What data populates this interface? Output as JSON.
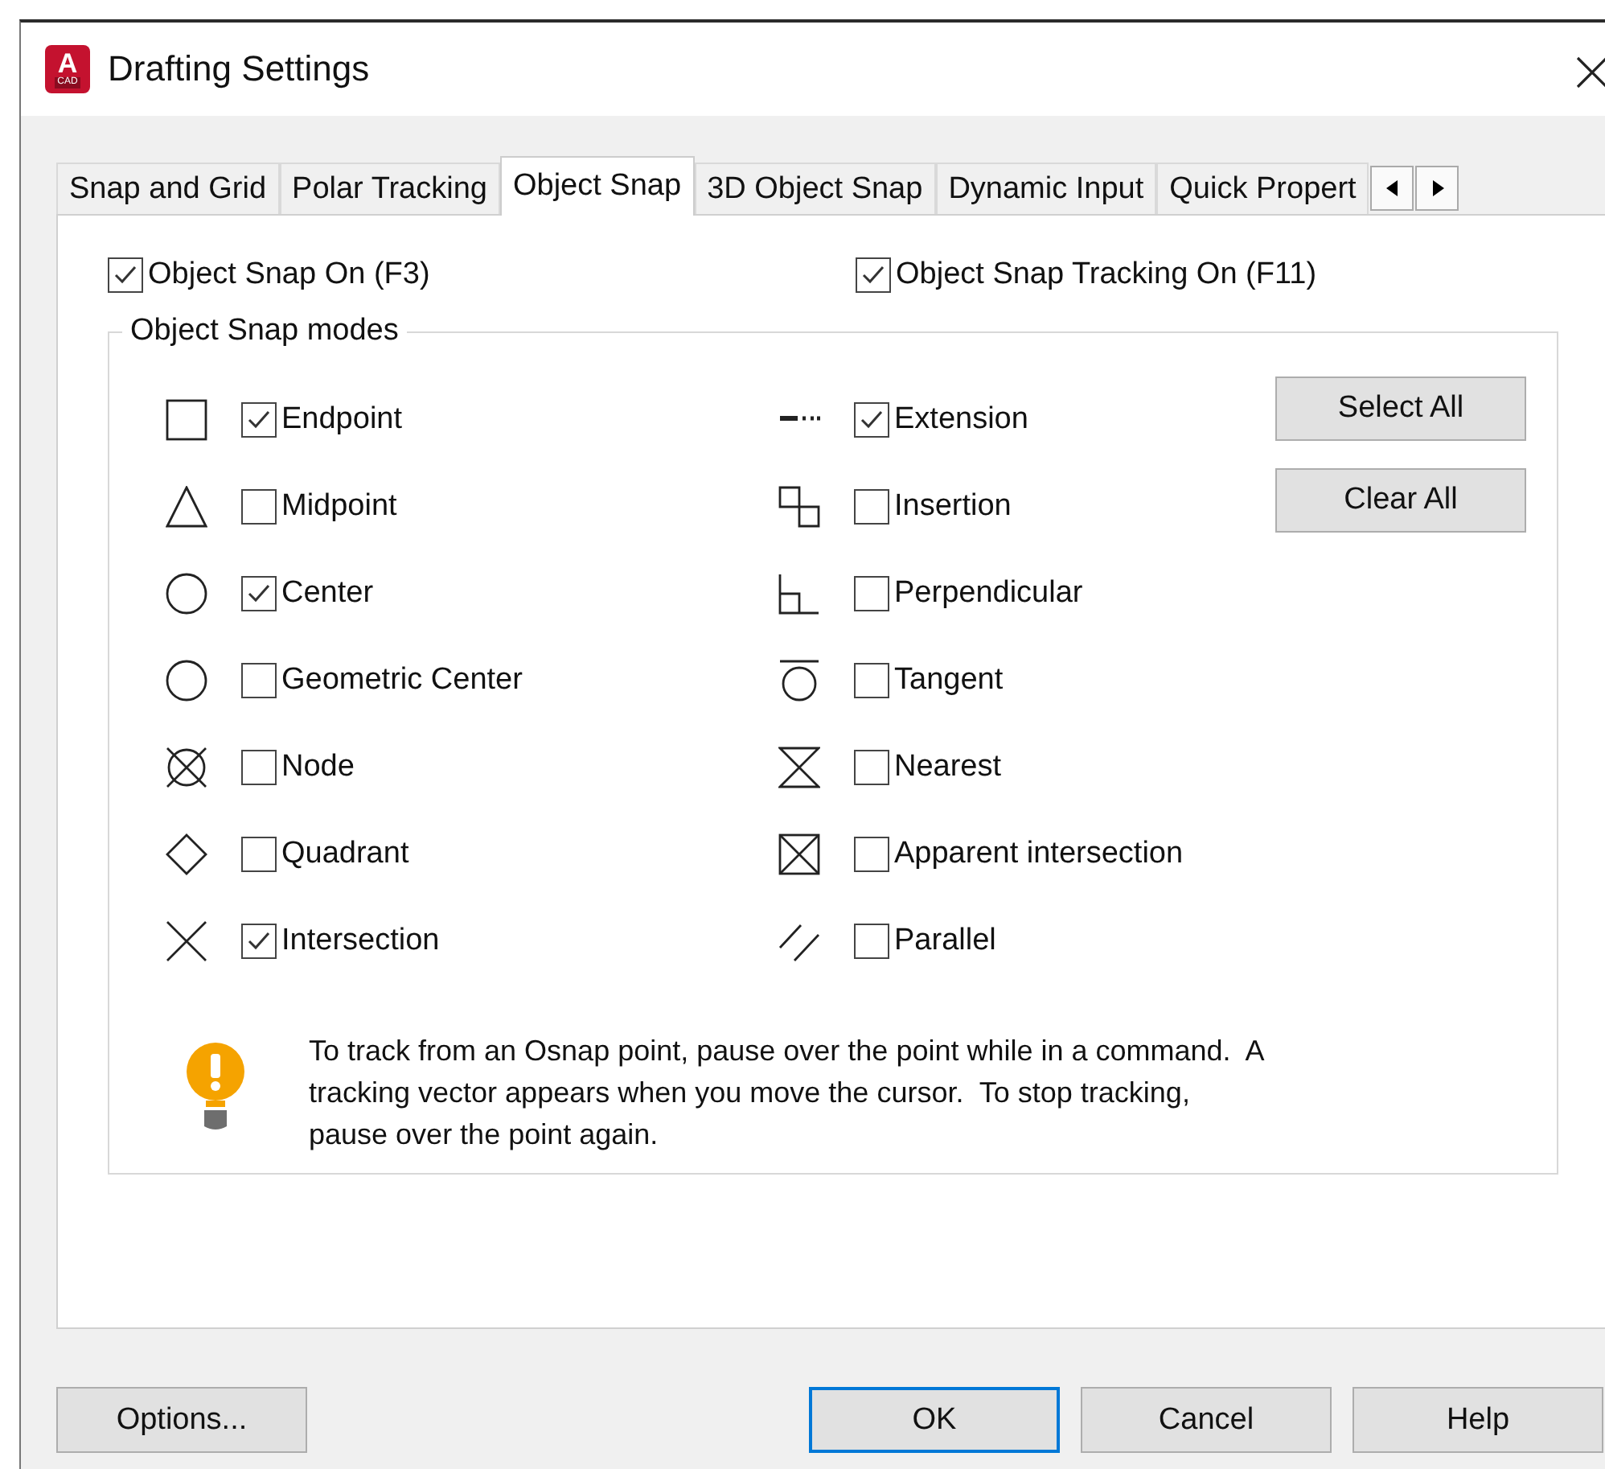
{
  "window": {
    "title": "Drafting Settings",
    "app_icon": {
      "letter": "A",
      "caption": "CAD"
    }
  },
  "tabs": [
    {
      "label": "Snap and Grid",
      "selected": false
    },
    {
      "label": "Polar Tracking",
      "selected": false
    },
    {
      "label": "Object Snap",
      "selected": true
    },
    {
      "label": "3D Object Snap",
      "selected": false
    },
    {
      "label": "Dynamic Input",
      "selected": false
    },
    {
      "label": "Quick Propert",
      "selected": false
    }
  ],
  "toggles": [
    {
      "label": "Object Snap On (F3)",
      "checked": true
    },
    {
      "label": "Object Snap Tracking On (F11)",
      "checked": true
    }
  ],
  "modes_group": {
    "title": "Object Snap modes",
    "columns": [
      [
        {
          "kind": "endpoint",
          "label": "Endpoint",
          "checked": true
        },
        {
          "kind": "midpoint",
          "label": "Midpoint",
          "checked": false
        },
        {
          "kind": "center",
          "label": "Center",
          "checked": true
        },
        {
          "kind": "geocenter",
          "label": "Geometric Center",
          "checked": false
        },
        {
          "kind": "node",
          "label": "Node",
          "checked": false
        },
        {
          "kind": "quadrant",
          "label": "Quadrant",
          "checked": false
        },
        {
          "kind": "intersection",
          "label": "Intersection",
          "checked": true
        }
      ],
      [
        {
          "kind": "extension",
          "label": "Extension",
          "checked": true
        },
        {
          "kind": "insertion",
          "label": "Insertion",
          "checked": false
        },
        {
          "kind": "perpendicular",
          "label": "Perpendicular",
          "checked": false
        },
        {
          "kind": "tangent",
          "label": "Tangent",
          "checked": false
        },
        {
          "kind": "nearest",
          "label": "Nearest",
          "checked": false
        },
        {
          "kind": "apparent",
          "label": "Apparent intersection",
          "checked": false
        },
        {
          "kind": "parallel",
          "label": "Parallel",
          "checked": false
        }
      ]
    ],
    "buttons": [
      "Select All",
      "Clear All"
    ],
    "tip": {
      "lines": [
        "To track from an Osnap point, pause over the point while in a command.  A",
        "tracking vector appears when you move the cursor.  To stop tracking,",
        "pause over the point again."
      ]
    }
  },
  "footer": {
    "options_button": "Options...",
    "buttons": [
      {
        "label": "OK",
        "default": true
      },
      {
        "label": "Cancel",
        "default": false
      },
      {
        "label": "Help",
        "default": false
      }
    ]
  }
}
